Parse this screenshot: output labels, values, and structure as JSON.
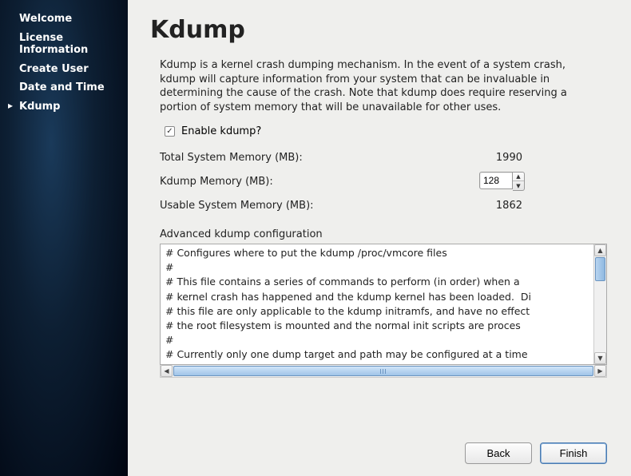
{
  "sidebar": {
    "items": [
      {
        "label": "Welcome"
      },
      {
        "label": "License Information"
      },
      {
        "label": "Create User"
      },
      {
        "label": "Date and Time"
      },
      {
        "label": "Kdump"
      }
    ],
    "active_index": 4
  },
  "page": {
    "title": "Kdump",
    "description": "Kdump is a kernel crash dumping mechanism. In the event of a system crash, kdump will capture information from your system that can be invaluable in determining the cause of the crash. Note that kdump does require reserving a portion of system memory that will be unavailable for other uses."
  },
  "enable": {
    "label": "Enable kdump?",
    "checked": true
  },
  "memory": {
    "total_label": "Total System Memory (MB):",
    "total_value": "1990",
    "kdump_label": "Kdump Memory (MB):",
    "kdump_value": "128",
    "usable_label": "Usable System Memory (MB):",
    "usable_value": "1862"
  },
  "advanced": {
    "label": "Advanced kdump configuration",
    "text": "# Configures where to put the kdump /proc/vmcore files\n#\n# This file contains a series of commands to perform (in order) when a\n# kernel crash has happened and the kdump kernel has been loaded.  Di\n# this file are only applicable to the kdump initramfs, and have no effect\n# the root filesystem is mounted and the normal init scripts are proces\n#\n# Currently only one dump target and path may be configured at a time\n# to configured dump target fails, the default action will be preformed."
  },
  "buttons": {
    "back": "Back",
    "finish": "Finish"
  }
}
